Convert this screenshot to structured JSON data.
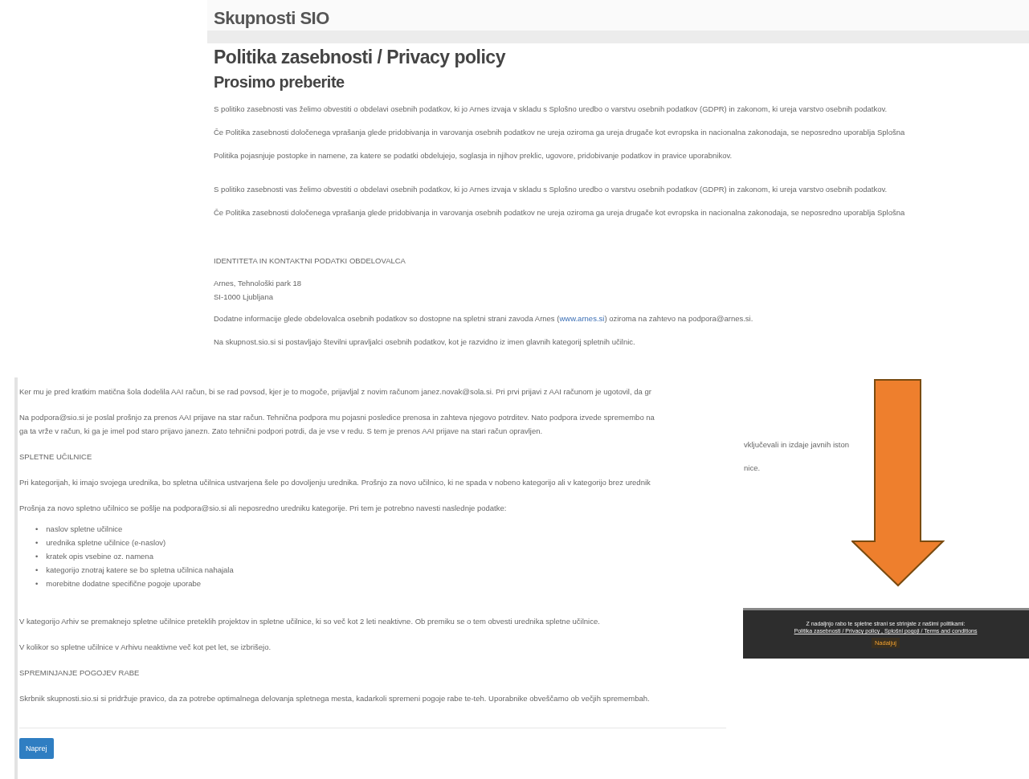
{
  "back_page": {
    "site_title": "Skupnosti SIO",
    "heading": "Politika zasebnosti / Privacy policy",
    "subheading": "Prosimo preberite",
    "blocks": [
      [
        {
          "kind": "text",
          "text": "S politiko zasebnosti vas želimo obvestiti o obdelavi osebnih podatkov, ki jo Arnes izvaja v skladu s Splošno uredbo o varstvu osebnih podatkov (GDPR) in zakonom, ki ureja varstvo osebnih podatkov."
        },
        {
          "kind": "text",
          "text": "Če Politika zasebnosti določenega vprašanja glede pridobivanja in varovanja osebnih podatkov ne ureja oziroma ga ureja drugače kot evropska in nacionalna zakonodaja, se neposredno uporablja Splošna"
        },
        {
          "kind": "text",
          "text": "Politika pojasnjuje postopke in namene, za katere se podatki obdelujejo, soglasja in njihov preklic, ugovore, pridobivanje podatkov in pravice uporabnikov."
        }
      ],
      [
        {
          "kind": "text",
          "text": "S politiko zasebnosti vas želimo obvestiti o obdelavi osebnih podatkov, ki jo Arnes izvaja v skladu s Splošno uredbo o varstvu osebnih podatkov (GDPR) in zakonom, ki ureja varstvo osebnih podatkov."
        },
        {
          "kind": "text",
          "text": "Če Politika zasebnosti določenega vprašanja glede pridobivanja in varovanja osebnih podatkov ne ureja oziroma ga ureja drugače kot evropska in nacionalna zakonodaja, se neposredno uporablja Splošna"
        }
      ],
      [
        {
          "kind": "label",
          "text": "IDENTITETA IN KONTAKTNI PODATKI OBDELOVALCA"
        },
        {
          "kind": "address",
          "lines": [
            "Arnes, Tehnološki park 18",
            "SI-1000 Ljubljana"
          ]
        },
        {
          "kind": "link_text",
          "before": "Dodatne informacije glede obdelovalca osebnih podatkov so dostopne na spletni strani zavoda Arnes (",
          "link": "www.arnes.si",
          "after": ") oziroma na zahtevo na podpora@arnes.si."
        },
        {
          "kind": "text",
          "text": "Na skupnost.sio.si si postavljajo številni upravljalci osebnih podatkov, kot je razvidno iz imen glavnih kategorij spletnih učilnic."
        }
      ]
    ],
    "fragments": [
      "vključevali in izdaje javnih iston",
      "nice."
    ],
    "cookie_bar": {
      "message": "Z nadaljnjo rabo te spletne strani se strinjate z našimi politikami:",
      "links": "Politika zasebnosti / Privacy policy , Splošni pogoji / Terms and conditions",
      "button": "Nadaljuj"
    }
  },
  "front_page": {
    "items": [
      {
        "kind": "text",
        "lines": [
          "Ker mu je pred kratkim matična šola dodelila AAI račun, bi se rad povsod, kjer je to mogoče, prijavljal z novim računom janez.novak@sola.si. Pri prvi prijavi z AAI računom je ugotovil, da gr"
        ]
      },
      {
        "kind": "text",
        "lines": [
          "Na podpora@sio.si je poslal prošnjo za prenos AAI prijave na star račun. Tehnična podpora mu pojasni posledice prenosa in zahteva njegovo potrditev. Nato podpora izvede spremembo na",
          "ga ta vrže v račun, ki ga je imel pod staro prijavo janezn. Zato tehnični podpori potrdi, da je vse v redu. S tem je prenos AAI prijave na stari račun opravljen."
        ]
      },
      {
        "kind": "label",
        "lines": [
          "SPLETNE UČILNICE"
        ]
      },
      {
        "kind": "text",
        "lines": [
          "Pri kategorijah, ki imajo svojega urednika, bo spletna učilnica ustvarjena šele po dovoljenju urednika. Prošnjo za novo učilnico, ki ne spada v nobeno kategorijo ali v kategorijo brez urednik"
        ]
      },
      {
        "kind": "text",
        "lines": [
          "Prošnja za novo spletno učilnico se pošlje na podpora@sio.si ali neposredno uredniku kategorije. Pri tem je potrebno navesti naslednje podatke:"
        ]
      },
      {
        "kind": "list",
        "bullet": "•",
        "lines": [
          "naslov spletne učilnice",
          "urednika spletne učilnice (e-naslov)",
          "kratek opis vsebine oz. namena",
          "kategorijo znotraj katere se bo spletna učilnica nahajala",
          "morebitne dodatne specifične pogoje uporabe"
        ]
      },
      {
        "kind": "text",
        "lines": [
          "V kategorijo Arhiv se premaknejo spletne učilnice preteklih projektov in spletne učilnice, ki so več kot 2 leti neaktivne. Ob premiku se o tem obvesti urednika spletne učilnice."
        ]
      },
      {
        "kind": "text",
        "lines": [
          "V kolikor so spletne učilnice v Arhivu neaktivne več kot pet let, se izbrišejo."
        ]
      },
      {
        "kind": "label",
        "lines": [
          "SPREMINJANJE POGOJEV RABE"
        ]
      },
      {
        "kind": "text",
        "lines": [
          "Skrbnik skupnosti.sio.si si pridržuje pravico, da za potrebe optimalnega delovanja spletnega mesta, kadarkoli spremeni pogoje rabe te-teh. Uporabnike obveščamo ob večjih spremembah."
        ]
      }
    ],
    "button": "Naprej"
  }
}
